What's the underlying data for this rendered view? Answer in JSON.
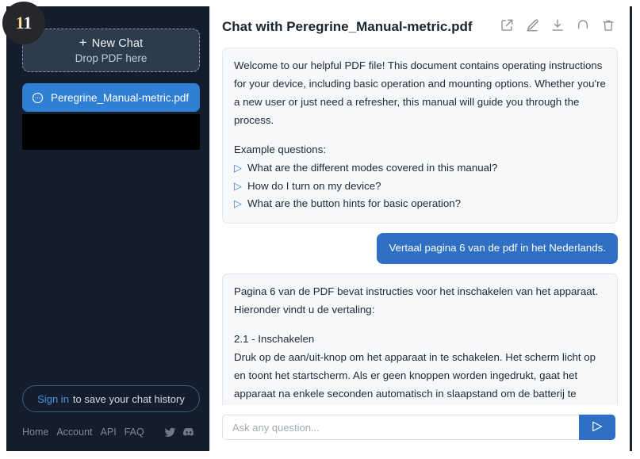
{
  "badge": {
    "number": "11"
  },
  "sidebar": {
    "new_chat": {
      "label": "New Chat",
      "plus": "+",
      "sublabel": "Drop PDF here",
      "icon": "plus-icon"
    },
    "files": [
      {
        "label": "Peregrine_Manual-metric.pdf",
        "icon": "chat-bubble-icon",
        "active": true
      }
    ],
    "signin": {
      "link_label": "Sign in",
      "rest_label": "to save your chat history"
    },
    "footer": {
      "links": [
        {
          "label": "Home"
        },
        {
          "label": "Account"
        },
        {
          "label": "API"
        },
        {
          "label": "FAQ"
        }
      ],
      "social": [
        {
          "name": "twitter-icon"
        },
        {
          "name": "discord-icon"
        }
      ]
    }
  },
  "header": {
    "title": "Chat with Peregrine_Manual-metric.pdf",
    "actions": [
      {
        "name": "share-icon",
        "label": "Share"
      },
      {
        "name": "edit-icon",
        "label": "Edit"
      },
      {
        "name": "download-icon",
        "label": "Download"
      },
      {
        "name": "refresh-icon",
        "label": "Reset"
      },
      {
        "name": "trash-icon",
        "label": "Delete"
      }
    ]
  },
  "messages": {
    "welcome": {
      "paragraph": "Welcome to our helpful PDF file! This document contains operating instructions for your device, including basic operation and mounting options. Whether you're a new user or just need a refresher, this manual will guide you through the process.",
      "examples_title": "Example questions:",
      "examples": [
        "What are the different modes covered in this manual?",
        "How do I turn on my device?",
        "What are the button hints for basic operation?"
      ]
    },
    "user": {
      "text": "Vertaal pagina 6 van de pdf in het Nederlands."
    },
    "assistant": {
      "intro": "Pagina 6 van de PDF bevat instructies voor het inschakelen van het apparaat. Hieronder vindt u de vertaling:",
      "heading": "2.1 - Inschakelen",
      "body": "Druk op de aan/uit-knop om het apparaat in te schakelen. Het scherm licht op en toont het startscherm. Als er geen knoppen worden ingedrukt, gaat het apparaat na enkele seconden automatisch in slaapstand om de batterij te sparen. Druk opnieuw op de aan/uit-knop om het apparaat uit de slaapstand te halen."
    }
  },
  "composer": {
    "placeholder": "Ask any question...",
    "value": "",
    "send_icon": "send-icon"
  },
  "colors": {
    "sidebar_bg": "#141d2b",
    "accent_blue": "#2f6fc4",
    "file_active": "#2f7fd4",
    "bubble_bg": "#f7f8fa",
    "badge_bg": "#26272b"
  }
}
